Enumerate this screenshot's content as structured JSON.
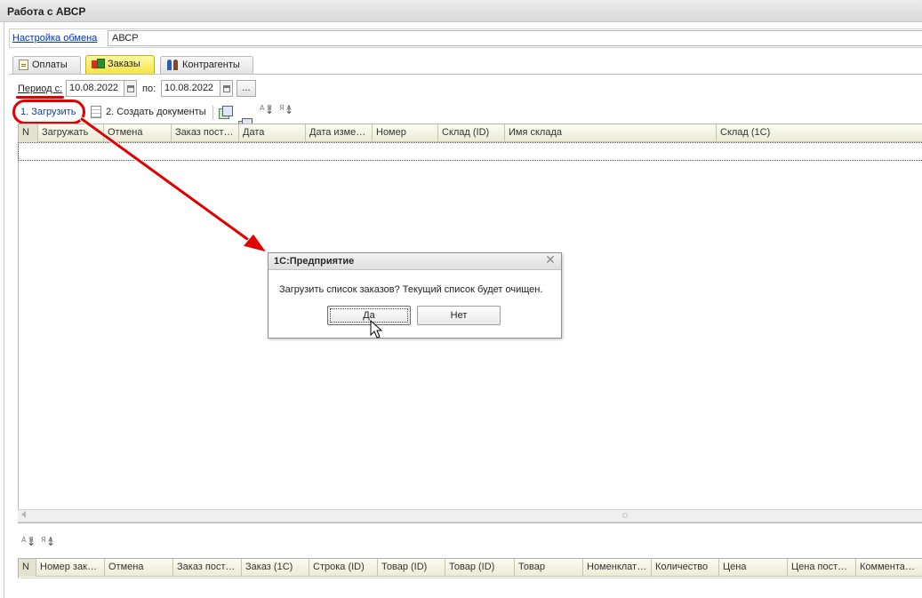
{
  "window": {
    "title": "Работа с АВСР"
  },
  "settings": {
    "link_label": "Настройка обмена",
    "value": "АВСР"
  },
  "tabs": [
    {
      "label": "Оплаты",
      "icon": "document-icon",
      "active": false
    },
    {
      "label": "Заказы",
      "icon": "orders-icon",
      "active": true
    },
    {
      "label": "Контрагенты",
      "icon": "people-icon",
      "active": false
    }
  ],
  "period": {
    "from_label": "Период с:",
    "from_value": "10.08.2022",
    "to_label": "по:",
    "to_value": "10.08.2022",
    "select_label": "..."
  },
  "toolbar": {
    "load_label": "1. Загрузить",
    "create_label": "2. Создать документы",
    "sort_asc": "А Я",
    "sort_desc": "Я А"
  },
  "orders_table": {
    "columns": [
      "N",
      "Загружать",
      "Отмена",
      "Заказ пост…",
      "Дата",
      "Дата измен…",
      "Номер",
      "Склад (ID)",
      "Имя склада",
      "Склад (1С)"
    ],
    "rows": []
  },
  "dialog": {
    "title": "1С:Предприятие",
    "message": "Загрузить список заказов? Текущий список будет очищен.",
    "yes_label": "Да",
    "no_label": "Нет",
    "close_glyph": "✕"
  },
  "items_table": {
    "columns": [
      "N",
      "Номер зака…",
      "Отмена",
      "Заказ поста…",
      "Заказ (1С)",
      "Строка (ID)",
      "Товар (ID)",
      "Товар (ID)",
      "Товар",
      "Номенклату…",
      "Количество",
      "Цена",
      "Цена поста…",
      "Комментар…"
    ],
    "rows": []
  },
  "colors": {
    "highlight_red": "#e00000",
    "active_tab": "#f5e23a",
    "link_blue": "#0033cc"
  }
}
